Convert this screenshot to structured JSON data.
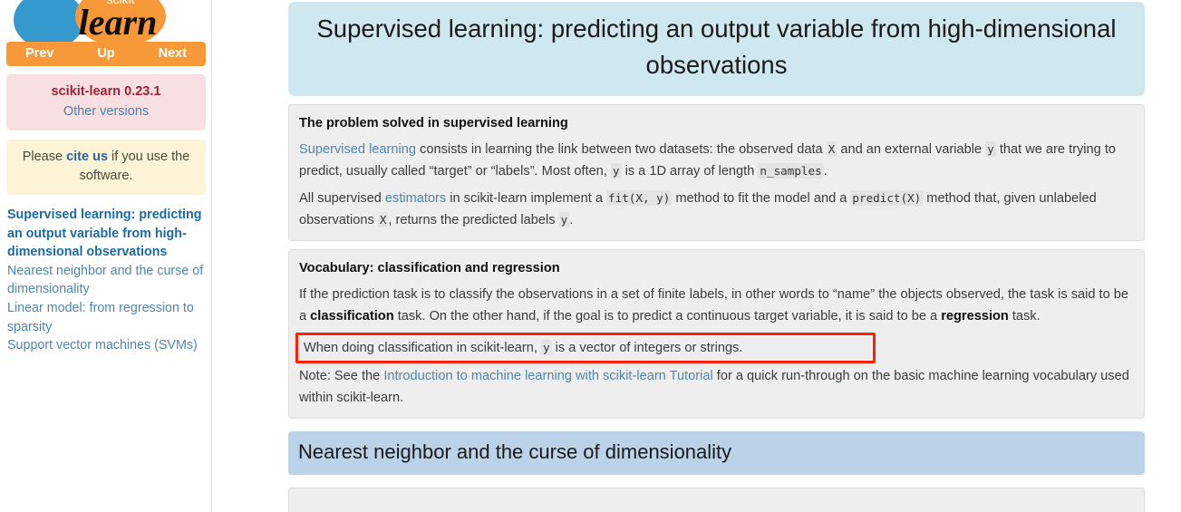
{
  "sidebar": {
    "logo": {
      "icon": "scikit-learn-logo",
      "text_top": "scikit",
      "text_main": "learn",
      "blue": "#3499cd",
      "orange": "#f89939"
    },
    "nav": {
      "prev_label": "Prev",
      "up_label": "Up",
      "next_label": "Next"
    },
    "version": {
      "title": "scikit-learn 0.23.1",
      "other_versions_label": "Other versions"
    },
    "cite": {
      "before": "Please ",
      "link_label": "cite us",
      "after": " if you use the software."
    },
    "toc_items": [
      {
        "label": "Supervised learning: predicting an output variable from high-dimensional observations",
        "current": true
      },
      {
        "label": "Nearest neighbor and the curse of dimensionality",
        "current": false
      },
      {
        "label": "Linear model: from regression to sparsity",
        "current": false
      },
      {
        "label": "Support vector machines (SVMs)",
        "current": false
      }
    ]
  },
  "main": {
    "page_title": "Supervised learning: predicting an output variable from high-dimensional observations",
    "topic1": {
      "title": "The problem solved in supervised learning",
      "p1": {
        "link_label": "Supervised learning",
        "t1": " consists in learning the link between two datasets: the observed data ",
        "code1": "X",
        "t2": " and an external variable ",
        "code2": "y",
        "t3": " that we are trying to predict, usually called “target” or “labels”. Most often, ",
        "code3": "y",
        "t4": " is a 1D array of length ",
        "code4": "n_samples",
        "t5": "."
      },
      "p2": {
        "t0": "All supervised ",
        "link_label": "estimators",
        "t1": " in scikit-learn implement a ",
        "code1": "fit(X, y)",
        "t2": " method to fit the model and a ",
        "code2": "predict(X)",
        "t3": " method that, given unlabeled observations ",
        "code3": "X",
        "t4": ", returns the predicted labels ",
        "code4": "y",
        "t5": "."
      }
    },
    "topic2": {
      "title": "Vocabulary: classification and regression",
      "p1": {
        "t0": "If the prediction task is to classify the observations in a set of finite labels, in other words to “name” the objects observed, the task is said to be a ",
        "b1": "classification",
        "t1": " task. On the other hand, if the goal is to predict a continuous target variable, it is said to be a ",
        "b2": "regression",
        "t2": " task."
      },
      "highlight": {
        "t0": "When doing classification in scikit-learn, ",
        "code1": "y",
        "t1": " is a vector of integers or strings.",
        "border_color": "#fa2108"
      },
      "p2": {
        "t0": "Note: See the ",
        "link_label": "Introduction to machine learning with scikit-learn Tutorial",
        "t1": " for a quick run-through on the basic machine learning vocabulary used within scikit-learn."
      }
    },
    "section_heading": "Nearest neighbor and the curse of dimensionality"
  }
}
